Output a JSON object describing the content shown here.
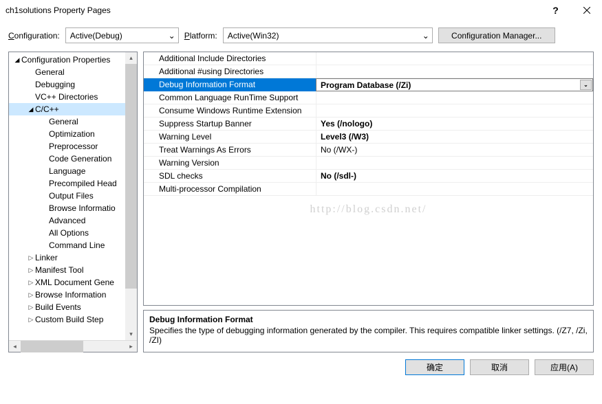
{
  "title": "ch1solutions Property Pages",
  "toolbar": {
    "config_label_pre": "C",
    "config_label_post": "onfiguration:",
    "config_value": "Active(Debug)",
    "platform_label_pre": "P",
    "platform_label_post": "latform:",
    "platform_value": "Active(Win32)",
    "cfgmgr_label": "Configuration Manager..."
  },
  "tree": [
    {
      "level": 0,
      "exp": "open",
      "label": "Configuration Properties"
    },
    {
      "level": 1,
      "exp": "",
      "label": "General"
    },
    {
      "level": 1,
      "exp": "",
      "label": "Debugging"
    },
    {
      "level": 1,
      "exp": "",
      "label": "VC++ Directories"
    },
    {
      "level": 1,
      "exp": "open",
      "label": "C/C++",
      "selected": true
    },
    {
      "level": 2,
      "exp": "",
      "label": "General"
    },
    {
      "level": 2,
      "exp": "",
      "label": "Optimization"
    },
    {
      "level": 2,
      "exp": "",
      "label": "Preprocessor"
    },
    {
      "level": 2,
      "exp": "",
      "label": "Code Generation"
    },
    {
      "level": 2,
      "exp": "",
      "label": "Language"
    },
    {
      "level": 2,
      "exp": "",
      "label": "Precompiled Head"
    },
    {
      "level": 2,
      "exp": "",
      "label": "Output Files"
    },
    {
      "level": 2,
      "exp": "",
      "label": "Browse Informatio"
    },
    {
      "level": 2,
      "exp": "",
      "label": "Advanced"
    },
    {
      "level": 2,
      "exp": "",
      "label": "All Options"
    },
    {
      "level": 2,
      "exp": "",
      "label": "Command Line"
    },
    {
      "level": 1,
      "exp": "closed",
      "label": "Linker"
    },
    {
      "level": 1,
      "exp": "closed",
      "label": "Manifest Tool"
    },
    {
      "level": 1,
      "exp": "closed",
      "label": "XML Document Gene"
    },
    {
      "level": 1,
      "exp": "closed",
      "label": "Browse Information"
    },
    {
      "level": 1,
      "exp": "closed",
      "label": "Build Events"
    },
    {
      "level": 1,
      "exp": "closed",
      "label": "Custom Build Step"
    }
  ],
  "grid": [
    {
      "name": "Additional Include Directories",
      "value": "",
      "bold": false
    },
    {
      "name": "Additional #using Directories",
      "value": "",
      "bold": false
    },
    {
      "name": "Debug Information Format",
      "value": "Program Database (/Zi)",
      "bold": true,
      "selected": true,
      "dd": true
    },
    {
      "name": "Common Language RunTime Support",
      "value": "",
      "bold": false
    },
    {
      "name": "Consume Windows Runtime Extension",
      "value": "",
      "bold": false
    },
    {
      "name": "Suppress Startup Banner",
      "value": "Yes (/nologo)",
      "bold": true
    },
    {
      "name": "Warning Level",
      "value": "Level3 (/W3)",
      "bold": true
    },
    {
      "name": "Treat Warnings As Errors",
      "value": "No (/WX-)",
      "bold": false
    },
    {
      "name": "Warning Version",
      "value": "",
      "bold": false
    },
    {
      "name": "SDL checks",
      "value": "No (/sdl-)",
      "bold": true
    },
    {
      "name": "Multi-processor Compilation",
      "value": "",
      "bold": false
    }
  ],
  "watermark": "http://blog.csdn.net/",
  "desc": {
    "title": "Debug Information Format",
    "text": "Specifies the type of debugging information generated by the compiler.  This requires compatible linker settings.    (/Z7, /Zi, /ZI)"
  },
  "footer": {
    "ok": "确定",
    "cancel": "取消",
    "apply": "应用(A)"
  }
}
